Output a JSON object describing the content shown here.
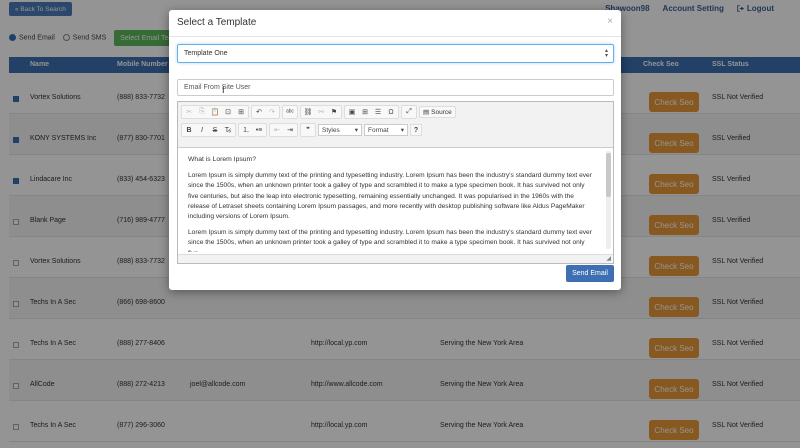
{
  "topbar": {
    "back_label": "« Back To Search",
    "username": "Shawoon98",
    "account_setting": "Account Setting",
    "logout": "Logout"
  },
  "send_options": {
    "email_label": "Send Email",
    "sms_label": "Send SMS",
    "select_button": "Select Email Tem"
  },
  "table": {
    "headers": {
      "name": "Name",
      "mobile": "Mobile Number",
      "check_seo": "Check Seo",
      "ssl": "SSL Status"
    },
    "check_seo_label": "Check Seo",
    "rows": [
      {
        "checked": true,
        "name": "Vortex Solutions",
        "phone": "(888) 833-7732",
        "email": "",
        "website": "",
        "area": "",
        "ssl": "SSL Not Verified"
      },
      {
        "checked": true,
        "name": "KONY SYSTEMS Inc",
        "phone": "(877) 830-7701",
        "email": "",
        "website": "",
        "area": "",
        "ssl": "SSL Verified"
      },
      {
        "checked": true,
        "name": "Lindacare Inc",
        "phone": "(833) 454-6323",
        "email": "",
        "website": "",
        "area": "",
        "ssl": "SSL Verified"
      },
      {
        "checked": false,
        "name": "Blank Page",
        "phone": "(716) 989-4777",
        "email": "",
        "website": "",
        "area": "",
        "ssl": "SSL Verified"
      },
      {
        "checked": false,
        "name": "Vortex Solutions",
        "phone": "(888) 833-7732",
        "email": "",
        "website": "",
        "area": "",
        "ssl": "SSL Not Verified"
      },
      {
        "checked": false,
        "name": "Techs In A Sec",
        "phone": "(866) 698-8600",
        "email": "",
        "website": "",
        "area": "",
        "ssl": "SSL Not Verified"
      },
      {
        "checked": false,
        "name": "Techs In A Sec",
        "phone": "(888) 277-8406",
        "email": "",
        "website": "http://local.yp.com",
        "area": "Serving the New York Area",
        "ssl": "SSL Not Verified"
      },
      {
        "checked": false,
        "name": "AllCode",
        "phone": "(888) 272-4213",
        "email": "joel@allcode.com",
        "website": "http://www.allcode.com",
        "area": "Serving the New York Area",
        "ssl": "SSL Not Verified"
      },
      {
        "checked": false,
        "name": "Techs In A Sec",
        "phone": "(877) 296-3060",
        "email": "",
        "website": "http://local.yp.com",
        "area": "Serving the New York Area",
        "ssl": "SSL Not Verified"
      }
    ]
  },
  "modal": {
    "title": "Select a Template",
    "close": "×",
    "template_selected": "Template One",
    "subject_value": "Email From Site User",
    "toolbar": {
      "source_label": "Source",
      "styles_label": "Styles",
      "format_label": "Format",
      "help_label": "?"
    },
    "content": {
      "heading": "What is Lorem Ipsum?",
      "para1": "Lorem Ipsum is simply dummy text of the printing and typesetting industry. Lorem Ipsum has been the industry's standard dummy text ever since the 1500s, when an unknown printer took a galley of type and scrambled it to make a type specimen book. It has survived not only five centuries, but also the leap into electronic typesetting, remaining essentially unchanged. It was popularised in the 1960s with the release of Letraset sheets containing Lorem Ipsum passages, and more recently with desktop publishing software like Aldus PageMaker including versions of Lorem Ipsum.",
      "para2": "Lorem Ipsum is simply dummy text of the printing and typesetting industry. Lorem Ipsum has been the industry's standard dummy text ever since the 1500s, when an unknown printer took a galley of type and scrambled it to make a type specimen book. It has survived not only five"
    },
    "send_button": "Send Email"
  },
  "colors": {
    "primary": "#3d6fb0",
    "seo_button": "#e89a3a",
    "select_button": "#5cb85c"
  }
}
